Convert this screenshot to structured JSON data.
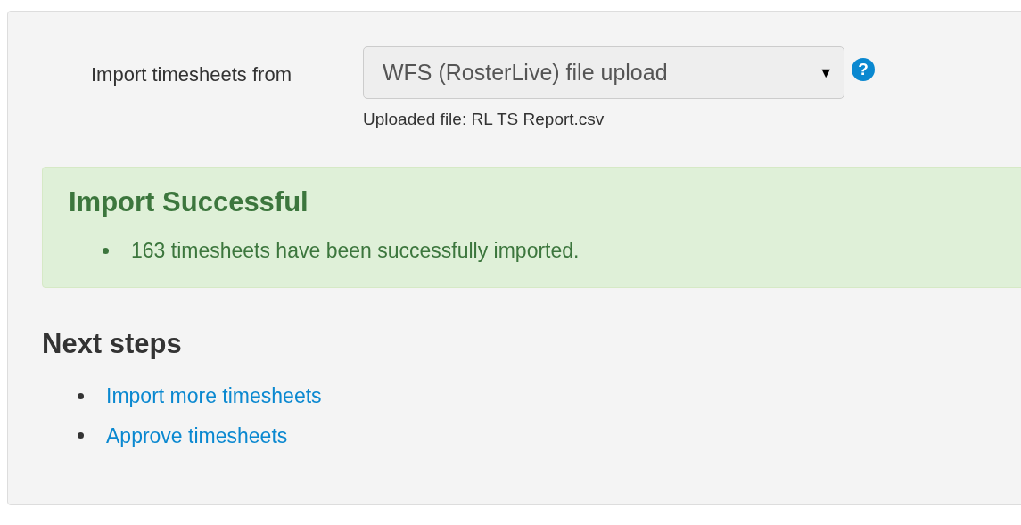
{
  "import_form": {
    "label": "Import timesheets from",
    "select": {
      "value": "WFS (RosterLive) file upload",
      "arrow": "▼"
    },
    "help": "?",
    "uploaded_file": "Uploaded file: RL TS Report.csv"
  },
  "alert": {
    "title": "Import Successful",
    "messages": [
      "163 timesheets have been successfully imported."
    ]
  },
  "next_steps": {
    "title": "Next steps",
    "links": [
      "Import more timesheets",
      "Approve timesheets"
    ]
  }
}
